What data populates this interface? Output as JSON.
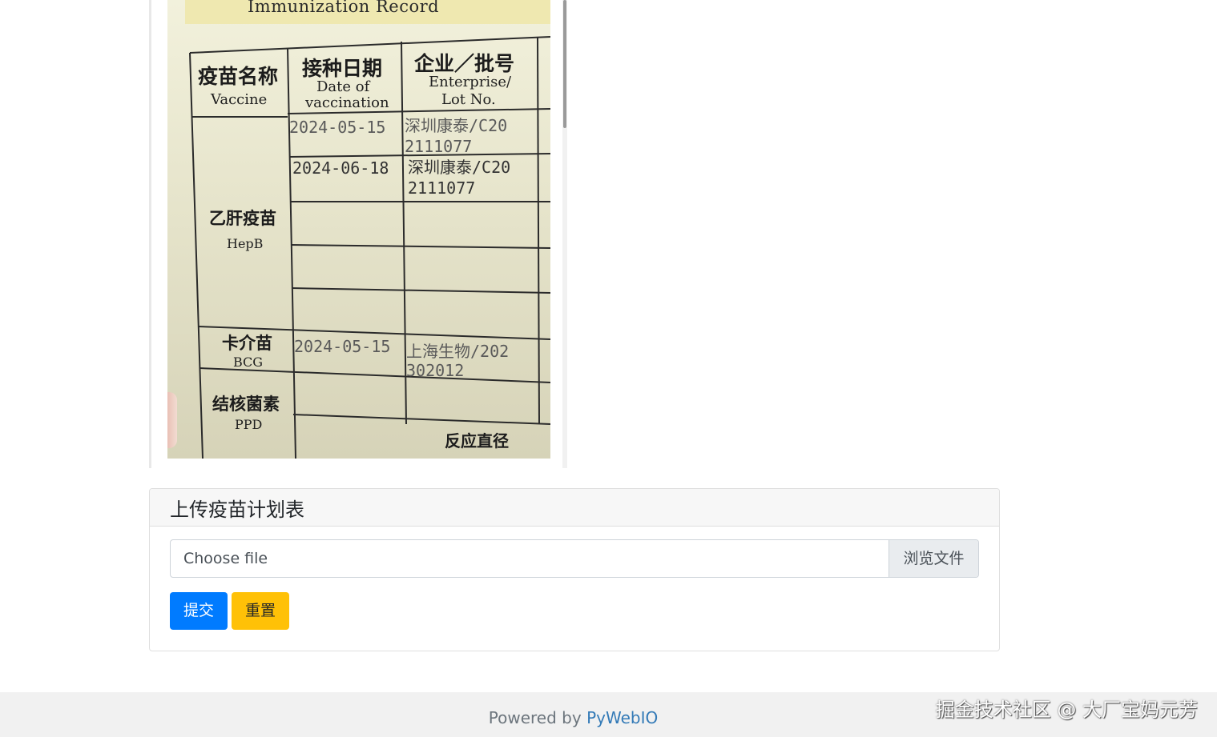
{
  "photo": {
    "subtitle": "Immunization Record",
    "headers": {
      "vaccine_cn": "疫苗名称",
      "vaccine_en": "Vaccine",
      "date_cn": "接种日期",
      "date_en1": "Date of",
      "date_en2": "vaccination",
      "ent_cn": "企业／批号",
      "ent_en1": "Enterprise/",
      "ent_en2": "Lot No."
    },
    "rows": {
      "hepb_cn": "乙肝疫苗",
      "hepb_en": "HepB",
      "bcg_cn": "卡介苗",
      "bcg_en": "BCG",
      "ppd_cn": "结核菌素",
      "ppd_en": "PPD"
    },
    "entries": {
      "d1": "2024-05-15",
      "e1a": "深圳康泰/C20",
      "e1b": "2111077",
      "d2": "2024-06-18",
      "e2a": "深圳康泰/C20",
      "e2b": "2111077",
      "d3": "2024-05-15",
      "e3a": "上海生物/202",
      "e3b": "302012"
    },
    "reaction": "反应直径"
  },
  "card": {
    "title": "上传疫苗计划表",
    "file_placeholder": "Choose file",
    "browse_label": "浏览文件",
    "submit_label": "提交",
    "reset_label": "重置"
  },
  "footer": {
    "prefix": "Powered by ",
    "link": "PyWebIO"
  },
  "watermark": "掘金技术社区 @ 大厂宝妈元芳",
  "colors": {
    "primary": "#007bff",
    "warning": "#ffc107",
    "footer_bg": "#f1f1f1"
  }
}
